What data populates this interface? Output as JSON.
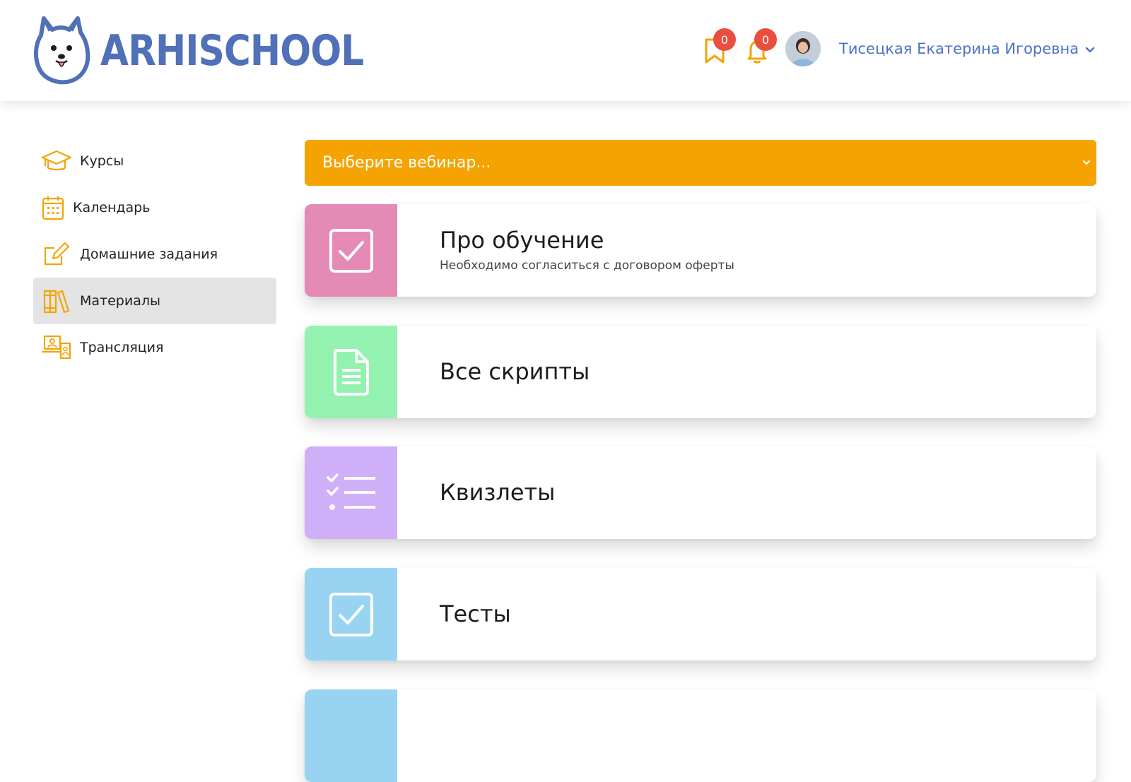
{
  "header": {
    "brand": "ARHISCHOOL",
    "bookmarks_count": "0",
    "notifications_count": "0",
    "user_name": "Тисецкая Екатерина Игоревна"
  },
  "sidebar": {
    "items": [
      {
        "label": "Курсы",
        "icon": "graduation-cap-icon"
      },
      {
        "label": "Календарь",
        "icon": "calendar-icon"
      },
      {
        "label": "Домашние задания",
        "icon": "edit-icon"
      },
      {
        "label": "Материалы",
        "icon": "books-icon",
        "active": true
      },
      {
        "label": "Трансляция",
        "icon": "broadcast-icon"
      }
    ]
  },
  "main": {
    "webinar_select": {
      "placeholder": "Выберите вебинар..."
    },
    "cards": [
      {
        "title": "Про обучение",
        "subtitle": "Необходимо согласиться с договором оферты",
        "color": "#e48ab4",
        "icon": "checkbox-icon"
      },
      {
        "title": "Все скрипты",
        "color": "#93f2b0",
        "icon": "document-icon"
      },
      {
        "title": "Квизлеты",
        "color": "#cfb0f8",
        "icon": "checklist-icon"
      },
      {
        "title": "Тесты",
        "color": "#98d4f2",
        "icon": "checkbox-icon"
      },
      {
        "color": "#98d4f2"
      }
    ]
  },
  "colors": {
    "accent": "#f5a302",
    "brand": "#5070b7",
    "badge": "#e94e3e",
    "active_bg": "#e4e4e4"
  }
}
